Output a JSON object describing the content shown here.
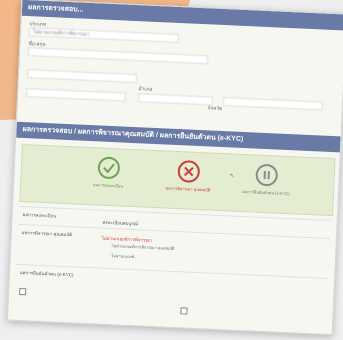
{
  "colors": {
    "background_accent": "#f2b88a",
    "header_bar": "#6a7aa6",
    "status_panel": "#e4ecd2",
    "success": "#6aa84f",
    "error": "#cc3a3a",
    "pending": "#8a8a8a"
  },
  "sections": {
    "top_header": "ผลการตรวจสอบ...",
    "result_header": "ผลการตรวจสอบ / ผลการพิจารณาคุณสมบัติ / ผลการยืนยันตัวตน (e-KYC)"
  },
  "fields": {
    "f1_label": "ประเภท",
    "f1_value": "ไม่ผ่านเกณฑ์การพิจารณา",
    "f2_label": "ชื่อ-สกุล",
    "f2_value": "",
    "f3_label": "",
    "f3_value": "",
    "f4_label": "อำเภอ",
    "f4_value": "",
    "f5_label": "จังหวัด",
    "f5_value": "",
    "f6_label": "",
    "f6_value": ""
  },
  "status_steps": [
    {
      "icon": "check-circle-icon",
      "label": "ผลการลงทะเบียน"
    },
    {
      "icon": "x-circle-icon",
      "label": "ผลการพิจารณา คุณสมบัติ"
    },
    {
      "icon": "pause-circle-icon",
      "label": "ผลการยืนยันตัวตน (e-KYC)"
    }
  ],
  "result_rows": {
    "row1_label": "ผลการลงทะเบียน",
    "row1_value": "ลงทะเบียนสมบูรณ์",
    "row2_label": "ผลการพิจารณา คุณสมบัติ",
    "row2_value": "ไม่ผ่านเกณฑ์การพิจารณา",
    "row2_b1": "- ไม่ผ่านเกณฑ์การพิจารณา คุณสมบัติ",
    "row2_b2": "- ไม่ผ่านเกณฑ์...",
    "row3_label": "ผลการยืนยันตัวตน (e-KYC)",
    "row3_value": ""
  },
  "footer": {
    "check1": "",
    "check2": "",
    "note": ""
  }
}
